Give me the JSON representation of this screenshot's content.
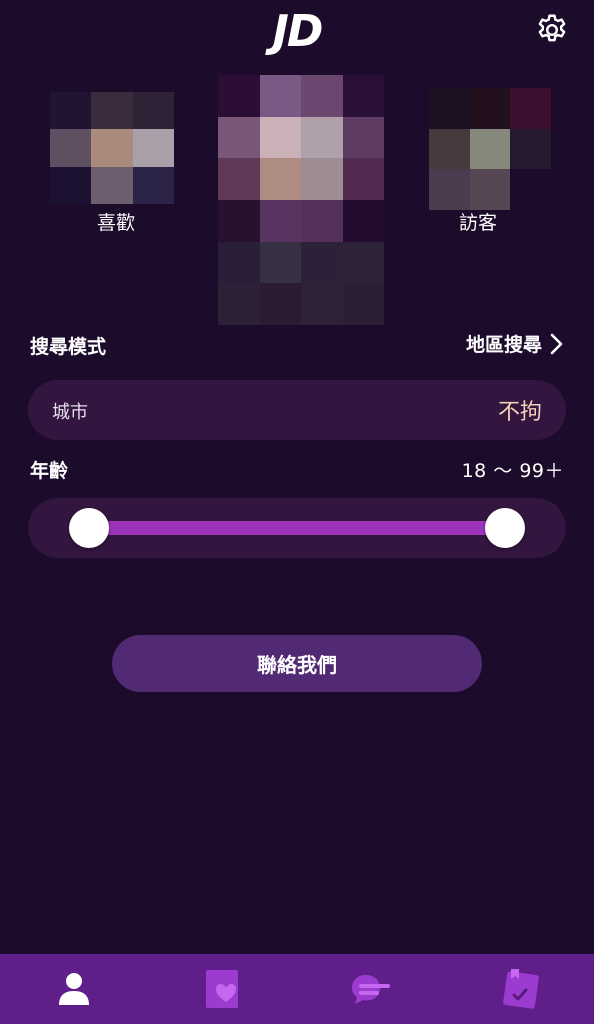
{
  "header": {
    "logo_text": "JD",
    "settings_icon": "gear-icon"
  },
  "photos": {
    "like_label": "喜歡",
    "visitor_label": "訪客",
    "like_colors": [
      "#211432",
      "#3a2c3d",
      "#2f2136",
      "#5f4f61",
      "#a98a7d",
      "#a9a0aa",
      "#1d1132",
      "#6c5e6f",
      "#2c2446"
    ],
    "main_colors": [
      "#2b0d35",
      "#7a5a85",
      "#6b4770",
      "#2a0f37",
      "#7a5678",
      "#cab1b7",
      "#b0a0aa",
      "#5e3b61",
      "#5e3a56",
      "#ae8b83",
      "#9e8c94",
      "#52294f",
      "#28102f",
      "#5a3460",
      "#55305a",
      "#230c2e",
      "#2a1e38",
      "#363042",
      "#2d2039",
      "#2e2238",
      "#2c2137",
      "#2b1c34",
      "#2f2138",
      "#2b1e35"
    ],
    "visitor_colors": [
      "#1d1023",
      "#22101e",
      "#3a0f30",
      "#473a3c",
      "#87887c",
      "#261a31",
      "#4d3b4f",
      "#574755",
      "#1c0b2a"
    ]
  },
  "search_mode": {
    "label": "搜尋模式",
    "value": "地區搜尋",
    "chevron_icon": "chevron-right-icon"
  },
  "city": {
    "label": "城市",
    "value": "不拘"
  },
  "age": {
    "label": "年齡",
    "value": "18 ～ 99＋",
    "min": 18,
    "max": 99,
    "range_fraction": [
      0,
      1
    ]
  },
  "contact_button": {
    "label": "聯絡我們"
  },
  "bottom_nav": {
    "items": [
      {
        "icon": "profile-icon",
        "active": true
      },
      {
        "icon": "heart-card-icon",
        "active": false
      },
      {
        "icon": "chat-bubble-icon",
        "active": false
      },
      {
        "icon": "checklist-icon",
        "active": false
      }
    ]
  },
  "colors": {
    "background": "#1c0b2a",
    "pill": "#32163f",
    "accent": "#9b34b8",
    "button": "#522a73",
    "nav_bar": "#601e8a",
    "nav_icon_inactive": "#9b3bd0",
    "city_value": "#f6cfb8"
  }
}
